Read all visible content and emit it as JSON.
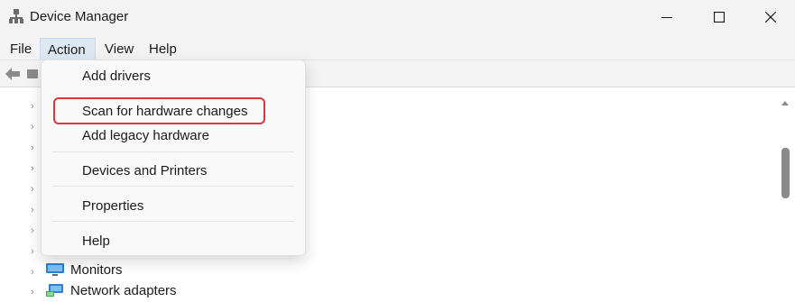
{
  "window": {
    "title": "Device Manager",
    "icons": [
      "device-manager-icon",
      "minimize-icon",
      "maximize-icon",
      "close-icon"
    ]
  },
  "menubar": {
    "items": [
      {
        "label": "File"
      },
      {
        "label": "Action"
      },
      {
        "label": "View"
      },
      {
        "label": "Help"
      }
    ]
  },
  "action_menu": {
    "items": [
      {
        "label": "Add drivers"
      },
      {
        "label": "Scan for hardware changes"
      },
      {
        "label": "Add legacy hardware"
      },
      {
        "label": "Devices and Printers"
      },
      {
        "label": "Properties"
      },
      {
        "label": "Help"
      }
    ],
    "highlight_color": "#d9363e"
  },
  "tree": {
    "nodes": [
      {
        "label": "Monitors",
        "icon": "monitor-icon"
      },
      {
        "label": "Network adapters",
        "icon": "network-adapter-icon"
      }
    ]
  },
  "colors": {
    "menu_active_bg": "#dde8f3",
    "window_bg": "#f3f3f3"
  }
}
